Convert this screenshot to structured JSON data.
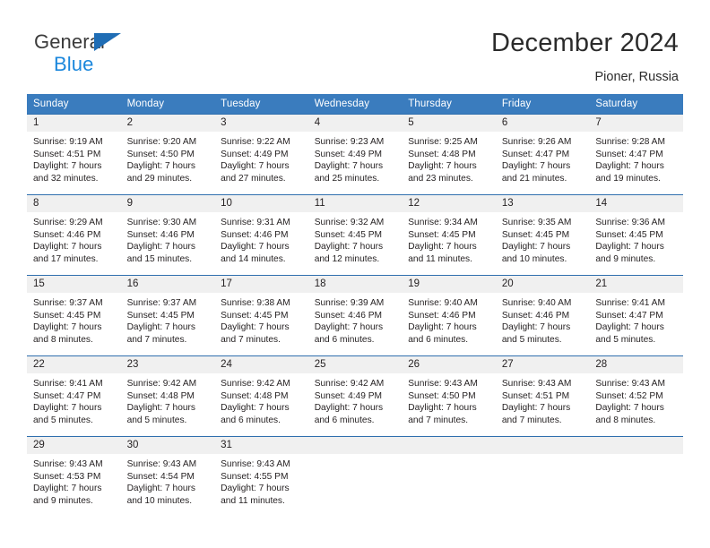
{
  "brand": {
    "name_dark": "General",
    "name_light": "Blue",
    "triangle_color": "#1f6db5",
    "blue_color": "#1b87dc"
  },
  "header": {
    "title": "December 2024",
    "location": "Pioner, Russia"
  },
  "theme": {
    "header_bg": "#3a7cbe",
    "row_divider": "#2f6fae",
    "daynum_bg": "#f0f0f0"
  },
  "weekdays": [
    "Sunday",
    "Monday",
    "Tuesday",
    "Wednesday",
    "Thursday",
    "Friday",
    "Saturday"
  ],
  "weeks": [
    [
      {
        "day": "1",
        "sunrise": "Sunrise: 9:19 AM",
        "sunset": "Sunset: 4:51 PM",
        "daylight1": "Daylight: 7 hours",
        "daylight2": "and 32 minutes."
      },
      {
        "day": "2",
        "sunrise": "Sunrise: 9:20 AM",
        "sunset": "Sunset: 4:50 PM",
        "daylight1": "Daylight: 7 hours",
        "daylight2": "and 29 minutes."
      },
      {
        "day": "3",
        "sunrise": "Sunrise: 9:22 AM",
        "sunset": "Sunset: 4:49 PM",
        "daylight1": "Daylight: 7 hours",
        "daylight2": "and 27 minutes."
      },
      {
        "day": "4",
        "sunrise": "Sunrise: 9:23 AM",
        "sunset": "Sunset: 4:49 PM",
        "daylight1": "Daylight: 7 hours",
        "daylight2": "and 25 minutes."
      },
      {
        "day": "5",
        "sunrise": "Sunrise: 9:25 AM",
        "sunset": "Sunset: 4:48 PM",
        "daylight1": "Daylight: 7 hours",
        "daylight2": "and 23 minutes."
      },
      {
        "day": "6",
        "sunrise": "Sunrise: 9:26 AM",
        "sunset": "Sunset: 4:47 PM",
        "daylight1": "Daylight: 7 hours",
        "daylight2": "and 21 minutes."
      },
      {
        "day": "7",
        "sunrise": "Sunrise: 9:28 AM",
        "sunset": "Sunset: 4:47 PM",
        "daylight1": "Daylight: 7 hours",
        "daylight2": "and 19 minutes."
      }
    ],
    [
      {
        "day": "8",
        "sunrise": "Sunrise: 9:29 AM",
        "sunset": "Sunset: 4:46 PM",
        "daylight1": "Daylight: 7 hours",
        "daylight2": "and 17 minutes."
      },
      {
        "day": "9",
        "sunrise": "Sunrise: 9:30 AM",
        "sunset": "Sunset: 4:46 PM",
        "daylight1": "Daylight: 7 hours",
        "daylight2": "and 15 minutes."
      },
      {
        "day": "10",
        "sunrise": "Sunrise: 9:31 AM",
        "sunset": "Sunset: 4:46 PM",
        "daylight1": "Daylight: 7 hours",
        "daylight2": "and 14 minutes."
      },
      {
        "day": "11",
        "sunrise": "Sunrise: 9:32 AM",
        "sunset": "Sunset: 4:45 PM",
        "daylight1": "Daylight: 7 hours",
        "daylight2": "and 12 minutes."
      },
      {
        "day": "12",
        "sunrise": "Sunrise: 9:34 AM",
        "sunset": "Sunset: 4:45 PM",
        "daylight1": "Daylight: 7 hours",
        "daylight2": "and 11 minutes."
      },
      {
        "day": "13",
        "sunrise": "Sunrise: 9:35 AM",
        "sunset": "Sunset: 4:45 PM",
        "daylight1": "Daylight: 7 hours",
        "daylight2": "and 10 minutes."
      },
      {
        "day": "14",
        "sunrise": "Sunrise: 9:36 AM",
        "sunset": "Sunset: 4:45 PM",
        "daylight1": "Daylight: 7 hours",
        "daylight2": "and 9 minutes."
      }
    ],
    [
      {
        "day": "15",
        "sunrise": "Sunrise: 9:37 AM",
        "sunset": "Sunset: 4:45 PM",
        "daylight1": "Daylight: 7 hours",
        "daylight2": "and 8 minutes."
      },
      {
        "day": "16",
        "sunrise": "Sunrise: 9:37 AM",
        "sunset": "Sunset: 4:45 PM",
        "daylight1": "Daylight: 7 hours",
        "daylight2": "and 7 minutes."
      },
      {
        "day": "17",
        "sunrise": "Sunrise: 9:38 AM",
        "sunset": "Sunset: 4:45 PM",
        "daylight1": "Daylight: 7 hours",
        "daylight2": "and 7 minutes."
      },
      {
        "day": "18",
        "sunrise": "Sunrise: 9:39 AM",
        "sunset": "Sunset: 4:46 PM",
        "daylight1": "Daylight: 7 hours",
        "daylight2": "and 6 minutes."
      },
      {
        "day": "19",
        "sunrise": "Sunrise: 9:40 AM",
        "sunset": "Sunset: 4:46 PM",
        "daylight1": "Daylight: 7 hours",
        "daylight2": "and 6 minutes."
      },
      {
        "day": "20",
        "sunrise": "Sunrise: 9:40 AM",
        "sunset": "Sunset: 4:46 PM",
        "daylight1": "Daylight: 7 hours",
        "daylight2": "and 5 minutes."
      },
      {
        "day": "21",
        "sunrise": "Sunrise: 9:41 AM",
        "sunset": "Sunset: 4:47 PM",
        "daylight1": "Daylight: 7 hours",
        "daylight2": "and 5 minutes."
      }
    ],
    [
      {
        "day": "22",
        "sunrise": "Sunrise: 9:41 AM",
        "sunset": "Sunset: 4:47 PM",
        "daylight1": "Daylight: 7 hours",
        "daylight2": "and 5 minutes."
      },
      {
        "day": "23",
        "sunrise": "Sunrise: 9:42 AM",
        "sunset": "Sunset: 4:48 PM",
        "daylight1": "Daylight: 7 hours",
        "daylight2": "and 5 minutes."
      },
      {
        "day": "24",
        "sunrise": "Sunrise: 9:42 AM",
        "sunset": "Sunset: 4:48 PM",
        "daylight1": "Daylight: 7 hours",
        "daylight2": "and 6 minutes."
      },
      {
        "day": "25",
        "sunrise": "Sunrise: 9:42 AM",
        "sunset": "Sunset: 4:49 PM",
        "daylight1": "Daylight: 7 hours",
        "daylight2": "and 6 minutes."
      },
      {
        "day": "26",
        "sunrise": "Sunrise: 9:43 AM",
        "sunset": "Sunset: 4:50 PM",
        "daylight1": "Daylight: 7 hours",
        "daylight2": "and 7 minutes."
      },
      {
        "day": "27",
        "sunrise": "Sunrise: 9:43 AM",
        "sunset": "Sunset: 4:51 PM",
        "daylight1": "Daylight: 7 hours",
        "daylight2": "and 7 minutes."
      },
      {
        "day": "28",
        "sunrise": "Sunrise: 9:43 AM",
        "sunset": "Sunset: 4:52 PM",
        "daylight1": "Daylight: 7 hours",
        "daylight2": "and 8 minutes."
      }
    ],
    [
      {
        "day": "29",
        "sunrise": "Sunrise: 9:43 AM",
        "sunset": "Sunset: 4:53 PM",
        "daylight1": "Daylight: 7 hours",
        "daylight2": "and 9 minutes."
      },
      {
        "day": "30",
        "sunrise": "Sunrise: 9:43 AM",
        "sunset": "Sunset: 4:54 PM",
        "daylight1": "Daylight: 7 hours",
        "daylight2": "and 10 minutes."
      },
      {
        "day": "31",
        "sunrise": "Sunrise: 9:43 AM",
        "sunset": "Sunset: 4:55 PM",
        "daylight1": "Daylight: 7 hours",
        "daylight2": "and 11 minutes."
      },
      {
        "day": "",
        "sunrise": "",
        "sunset": "",
        "daylight1": "",
        "daylight2": ""
      },
      {
        "day": "",
        "sunrise": "",
        "sunset": "",
        "daylight1": "",
        "daylight2": ""
      },
      {
        "day": "",
        "sunrise": "",
        "sunset": "",
        "daylight1": "",
        "daylight2": ""
      },
      {
        "day": "",
        "sunrise": "",
        "sunset": "",
        "daylight1": "",
        "daylight2": ""
      }
    ]
  ]
}
